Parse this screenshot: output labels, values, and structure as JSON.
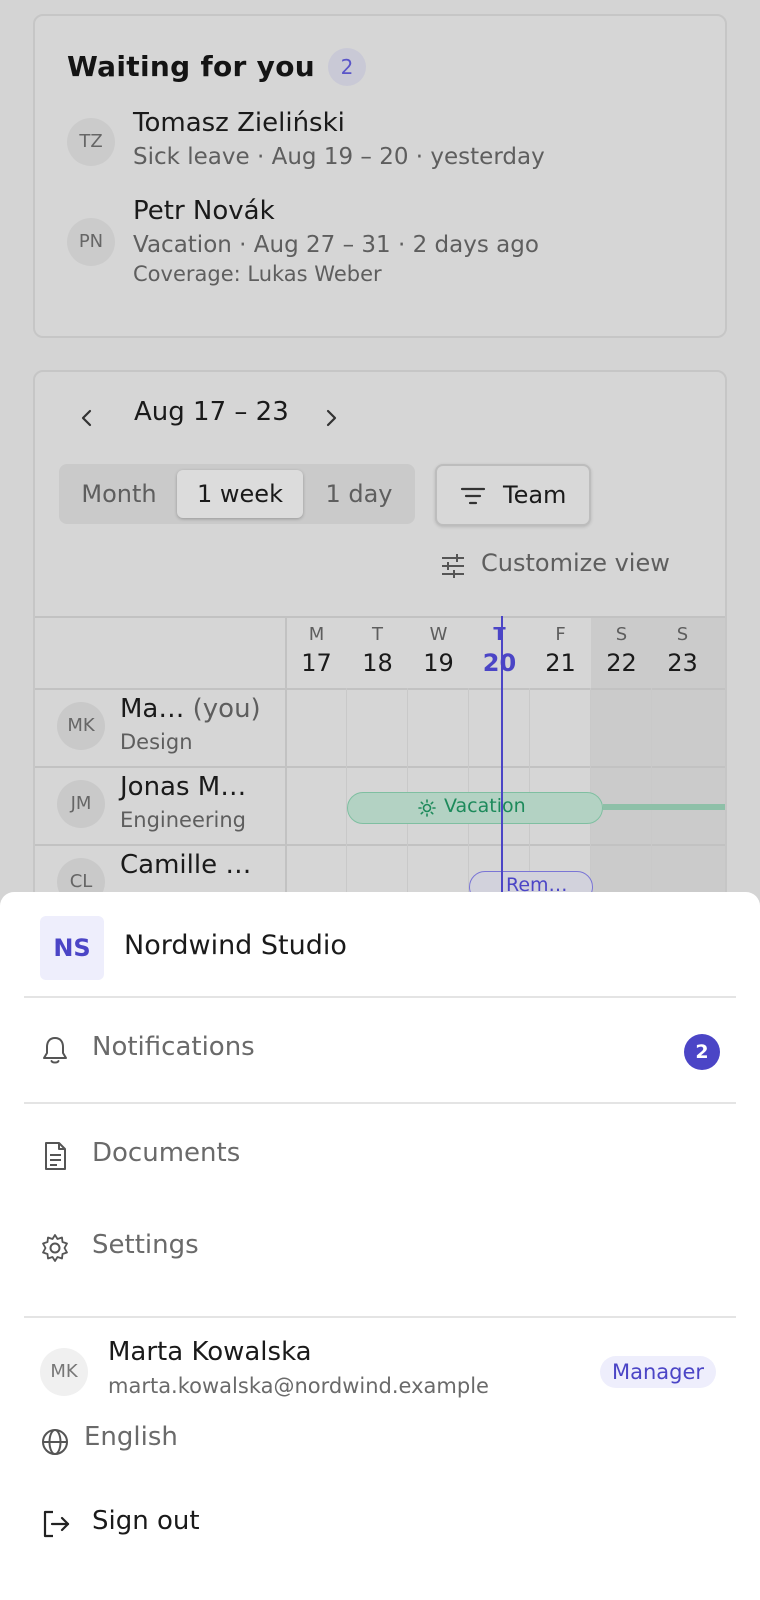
{
  "waiting": {
    "title": "Waiting for you",
    "count": "2",
    "requests": [
      {
        "initials": "TZ",
        "name": "Tomasz Zieliński",
        "detail": "Sick leave · Aug 19 – 20 · yesterday",
        "coverage": ""
      },
      {
        "initials": "PN",
        "name": "Petr Novák",
        "detail": "Vacation · Aug 27 – 31 · 2 days ago",
        "coverage": "Coverage: Lukas Weber"
      }
    ]
  },
  "calendar": {
    "range": "Aug 17 – 23",
    "views": [
      "Month",
      "1 week",
      "1 day"
    ],
    "active_view": "1 week",
    "filter_label": "Team",
    "customize_label": "Customize view",
    "days": [
      {
        "letter": "M",
        "num": "17"
      },
      {
        "letter": "T",
        "num": "18"
      },
      {
        "letter": "W",
        "num": "19"
      },
      {
        "letter": "T",
        "num": "20",
        "today": true
      },
      {
        "letter": "F",
        "num": "21"
      },
      {
        "letter": "S",
        "num": "22",
        "weekend": true
      },
      {
        "letter": "S",
        "num": "23",
        "weekend": true
      }
    ],
    "members": [
      {
        "initials": "MK",
        "name": "Ma…",
        "you": "(you)",
        "team": "Design"
      },
      {
        "initials": "JM",
        "name": "Jonas M…",
        "you": "",
        "team": "Engineering"
      },
      {
        "initials": "CL",
        "name": "Camille …",
        "you": "",
        "team": ""
      }
    ],
    "events": {
      "vacation_label": "Vacation",
      "remote_label": "Rem…"
    }
  },
  "sheet": {
    "org_initials": "NS",
    "org_name": "Nordwind Studio",
    "notifications_label": "Notifications",
    "notifications_count": "2",
    "documents_label": "Documents",
    "settings_label": "Settings",
    "user": {
      "initials": "MK",
      "name": "Marta Kowalska",
      "email": "marta.kowalska@nordwind.example",
      "role": "Manager"
    },
    "language_label": "English",
    "signout_label": "Sign out"
  },
  "colors": {
    "accent": "#4b45c6",
    "vacation": "#1d8a5b",
    "overlay": "#d4d4d4"
  }
}
